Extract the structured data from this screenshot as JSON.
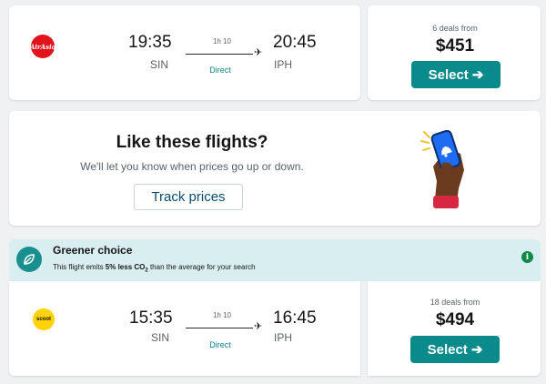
{
  "flights": [
    {
      "airline_icon": "airasia-logo",
      "airline_logo_text": "AirAsia",
      "depart_time": "19:35",
      "depart_airport": "SIN",
      "arrive_time": "20:45",
      "arrive_airport": "IPH",
      "duration": "1h 10",
      "stops": "Direct",
      "deals": "6 deals from",
      "price": "$451",
      "select_label": "Select"
    },
    {
      "airline_icon": "scoot-logo",
      "airline_logo_text": "scoot",
      "depart_time": "15:35",
      "depart_airport": "SIN",
      "arrive_time": "16:45",
      "arrive_airport": "IPH",
      "duration": "1h 10",
      "stops": "Direct",
      "deals": "18 deals from",
      "price": "$494",
      "select_label": "Select"
    }
  ],
  "track": {
    "title": "Like these flights?",
    "subtitle": "We'll let you know when prices go up or down.",
    "button_label": "Track prices",
    "illustration_icon": "hand-phone-bell-icon"
  },
  "greener": {
    "title": "Greener choice",
    "text_before": "This flight emits ",
    "text_bold": "5% less CO",
    "text_sub": "2",
    "text_after": " than the average for your search",
    "leaf_icon": "leaf-icon",
    "info_icon": "info-icon"
  },
  "colors": {
    "accent": "#0a8a8a",
    "background": "#eff1f2",
    "green_banner": "#d9eef0",
    "airasia": "#e1131d",
    "scoot": "#ffd20a"
  }
}
